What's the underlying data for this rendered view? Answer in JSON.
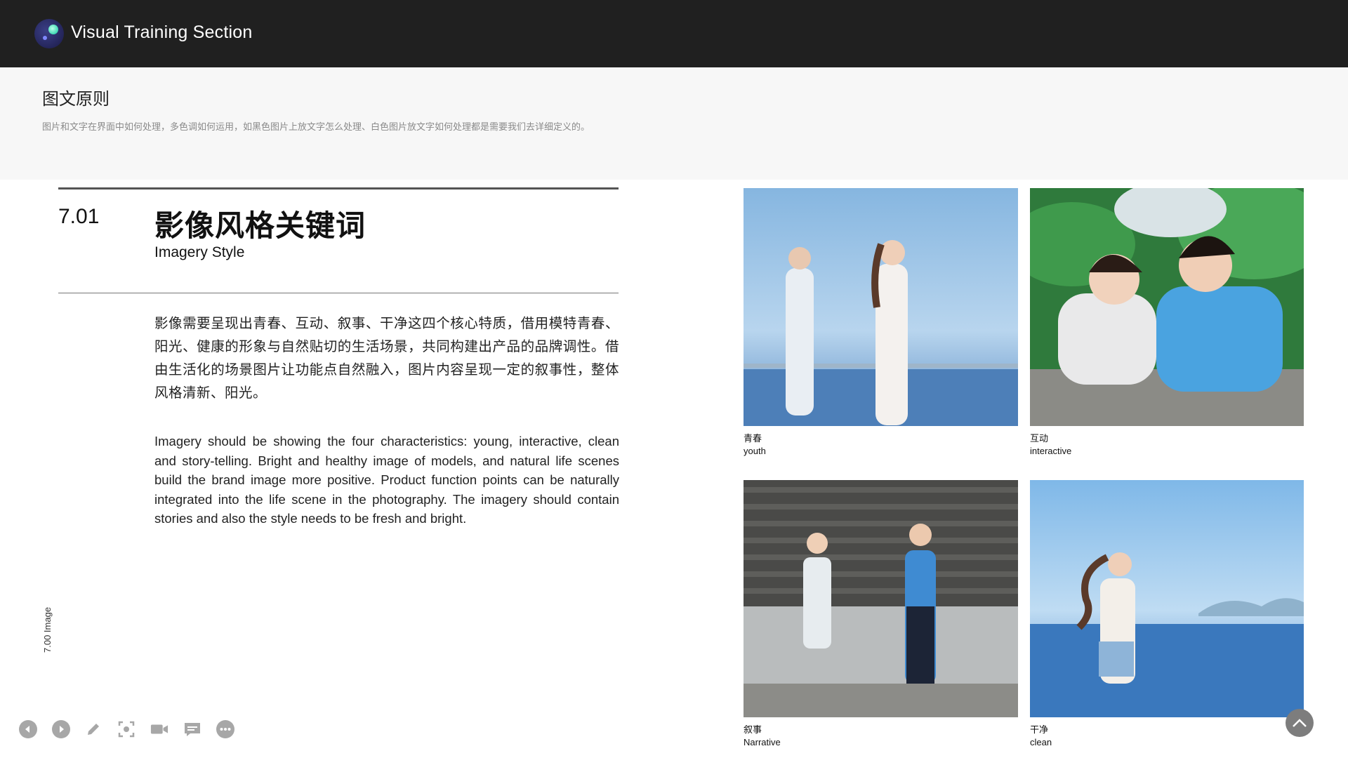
{
  "app": {
    "title": "Visual Training Section",
    "logo": "app-logo"
  },
  "header": {
    "title": "图文原则",
    "description": "图片和文字在界面中如何处理，多色调如何运用，如黑色图片上放文字怎么处理、白色图片放文字如何处理都是需要我们去详细定义的。"
  },
  "section": {
    "number": "7.01",
    "title_cn": "影像风格关键词",
    "title_en": "Imagery Style",
    "body_cn": "影像需要呈现出青春、互动、叙事、干净这四个核心特质，借用模特青春、阳光、健康的形象与自然贴切的生活场景，共同构建出产品的品牌调性。借由生活化的场景图片让功能点自然融入，图片内容呈现一定的叙事性，整体风格清新、阳光。",
    "body_en": "Imagery should be showing the four characteristics: young, interactive, clean and story-telling. Bright and healthy image of models, and natural life scenes build the brand image more positive. Product function points can be naturally integrated into the life scene in the photography. The imagery should contain stories and also the style needs to be fresh and bright.",
    "side_label": "7.00  Image"
  },
  "gallery": [
    {
      "cn": "青春",
      "en": "youth"
    },
    {
      "cn": "互动",
      "en": "interactive"
    },
    {
      "cn": "叙事",
      "en": "Narrative"
    },
    {
      "cn": "干净",
      "en": "clean"
    }
  ],
  "toolbar": {
    "items": [
      "prev-icon",
      "next-icon",
      "pen-icon",
      "screenshot-icon",
      "video-icon",
      "comment-icon",
      "more-icon"
    ]
  },
  "colors": {
    "topbar": "#202020",
    "header_bg": "#f7f7f7",
    "accent": "#3fd9b4"
  }
}
